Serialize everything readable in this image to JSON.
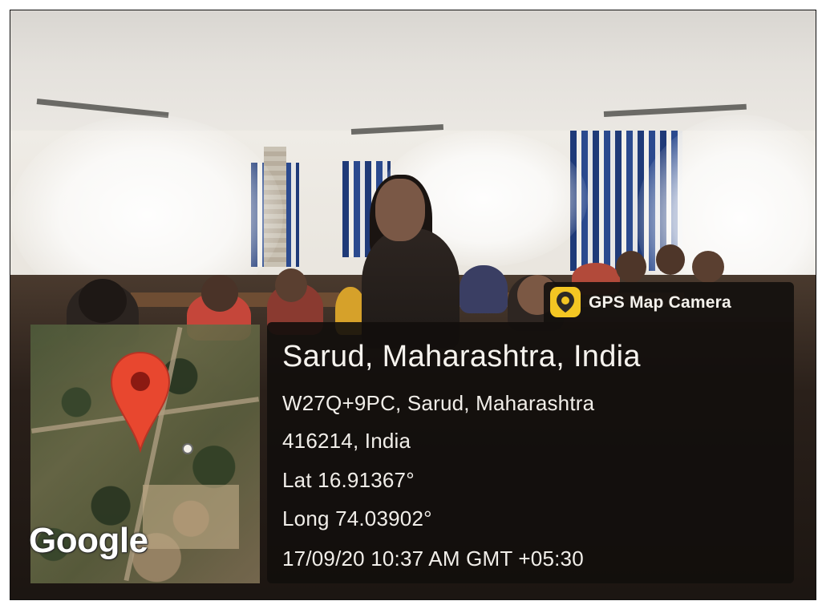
{
  "app": {
    "brand_label": "GPS Map Camera",
    "brand_icon": "gps-map-camera-icon"
  },
  "location": {
    "title": "Sarud, Maharashtra, India",
    "address_line1": "W27Q+9PC, Sarud, Maharashtra",
    "address_line2": "416214, India",
    "latitude": "Lat 16.91367°",
    "longitude": "Long 74.03902°",
    "datetime": "17/09/20 10:37 AM GMT +05:30"
  },
  "map": {
    "provider_logo": "Google",
    "pin_icon": "map-pin-icon",
    "pin_color": "#e8472f"
  },
  "colors": {
    "panel_bg": "#120e0c",
    "text": "#f4f1ec",
    "brand_icon_bg": "#f3c623"
  }
}
